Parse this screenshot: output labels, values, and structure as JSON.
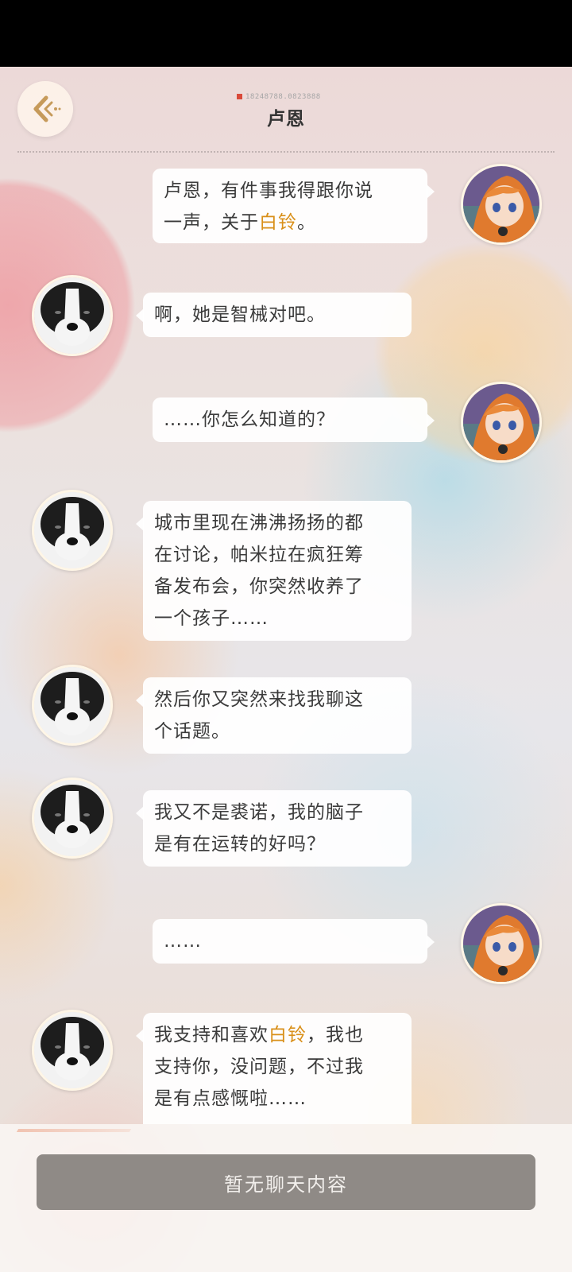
{
  "header": {
    "title": "卢恩",
    "id_text": "18248788.0823888"
  },
  "bottom": {
    "placeholder": "暂无聊天内容"
  },
  "colors": {
    "highlight": "#d9901a",
    "bubble": "#ffffff",
    "input_bar": "#8f8a86"
  },
  "messages": [
    {
      "side": "right",
      "avatar": "girl-avatar",
      "line1": "卢恩，有件事我得跟你说",
      "line2_pre": "一声，关于",
      "line2_hl": "白铃",
      "line2_post": "。"
    },
    {
      "side": "left",
      "avatar": "dog-avatar",
      "text": "啊，她是智械对吧。"
    },
    {
      "side": "right",
      "avatar": "girl-avatar",
      "text": "……你怎么知道的？"
    },
    {
      "side": "left",
      "avatar": "dog-avatar",
      "lines": [
        "城市里现在沸沸扬扬的都",
        "在讨论，帕米拉在疯狂筹",
        "备发布会，你突然收养了",
        "一个孩子……"
      ]
    },
    {
      "side": "left",
      "avatar": "dog-avatar",
      "lines": [
        "然后你又突然来找我聊这",
        "个话题。"
      ]
    },
    {
      "side": "left",
      "avatar": "dog-avatar",
      "lines": [
        "我又不是裘诺，我的脑子",
        "是有在运转的好吗？"
      ]
    },
    {
      "side": "right",
      "avatar": "girl-avatar",
      "text": "……"
    },
    {
      "side": "left",
      "avatar": "dog-avatar",
      "line1_pre": "我支持和喜欢",
      "line1_hl": "白铃",
      "line1_post": "，我也",
      "line2": "支持你，没问题，不过我",
      "line3": "是有点感慨啦……"
    }
  ]
}
